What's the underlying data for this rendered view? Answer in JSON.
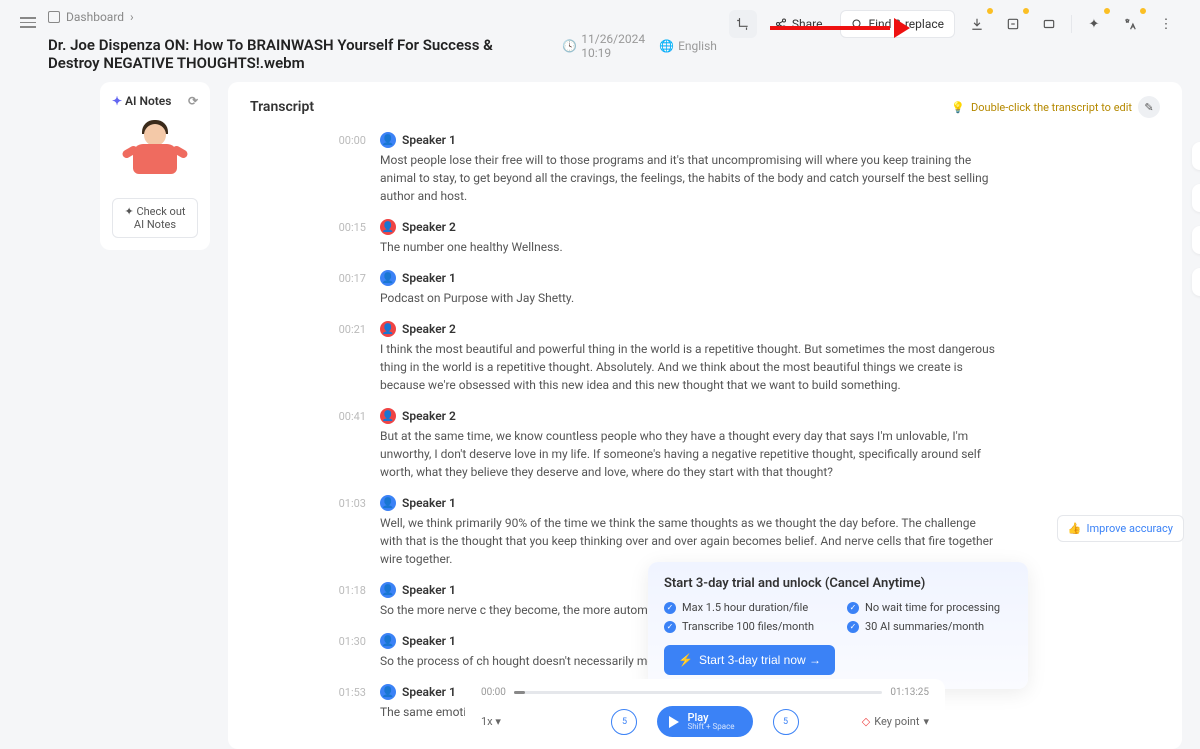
{
  "breadcrumb": {
    "home": "Dashboard",
    "chev": "›"
  },
  "title": "Dr. Joe Dispenza ON: How To BRAINWASH Yourself For Success & Destroy NEGATIVE THOUGHTS!.webm",
  "meta": {
    "date": "11/26/2024 10:19",
    "lang": "English"
  },
  "toolbar": {
    "share": "Share",
    "find": "Find & replace"
  },
  "sidebar": {
    "ai_notes": "AI Notes",
    "check_out": "Check out AI Notes"
  },
  "content": {
    "heading": "Transcript",
    "hint": "Double-click the transcript to edit"
  },
  "segments": [
    {
      "ts": "00:00",
      "sp": "Speaker 1",
      "col": "b",
      "text": "Most people lose their free will to those programs and it's that uncompromising will where you keep training the animal to stay, to get beyond all the cravings, the feelings, the habits of the body and catch yourself the best selling author and host."
    },
    {
      "ts": "00:15",
      "sp": "Speaker 2",
      "col": "r",
      "text": "The number one healthy Wellness."
    },
    {
      "ts": "00:17",
      "sp": "Speaker 1",
      "col": "b",
      "text": "Podcast on Purpose with Jay Shetty."
    },
    {
      "ts": "00:21",
      "sp": "Speaker 2",
      "col": "r",
      "text": "I think the most beautiful and powerful thing in the world is a repetitive thought. But sometimes the most dangerous thing in the world is a repetitive thought. Absolutely. And we think about the most beautiful things we create is because we're obsessed with this new idea and this new thought that we want to build something."
    },
    {
      "ts": "00:41",
      "sp": "Speaker 2",
      "col": "r",
      "text": "But at the same time, we know countless people who they have a thought every day that says I'm unlovable, I'm unworthy, I don't deserve love in my life. If someone's having a negative repetitive thought, specifically around self worth, what they believe they deserve and love, where do they start with that thought?"
    },
    {
      "ts": "01:03",
      "sp": "Speaker 1",
      "col": "b",
      "text": "Well, we think primarily 90% of the time we think the same thoughts as we thought the day before. The challenge with that is the thought that you keep thinking over and over again becomes belief. And nerve cells that fire together wire together."
    },
    {
      "ts": "01:18",
      "sp": "Speaker 1",
      "col": "b",
      "text": "So the more nerve c                                                                                                                                                                                                    they become, the more automatic they"
    },
    {
      "ts": "01:30",
      "sp": "Speaker 1",
      "col": "b",
      "text": "So the process of ch                                                                                                                                                                                                   hought doesn't necessarily mean it's                                                                                                                                                                                                   hought will lead to the same choice, wh                                                                                                                                                                                                    on."
    },
    {
      "ts": "01:53",
      "sp": "Speaker 1",
      "col": "b",
      "text": "The same emotions                                                                                                                                                                                                    in our gene"
    }
  ],
  "trial": {
    "title": "Start 3-day trial and unlock (Cancel Anytime)",
    "features": [
      "Max 1.5 hour duration/file",
      "No wait time for processing",
      "Transcribe 100 files/month",
      "30 AI summaries/month"
    ],
    "cta": "Start 3-day trial now →"
  },
  "player": {
    "cur": "00:00",
    "total": "01:13:25",
    "speed": "1x",
    "back": "5",
    "fwd": "5",
    "play": "Play",
    "shortcut": "Shift + Space",
    "keypoint": "Key point"
  },
  "improve": "Improve accuracy"
}
